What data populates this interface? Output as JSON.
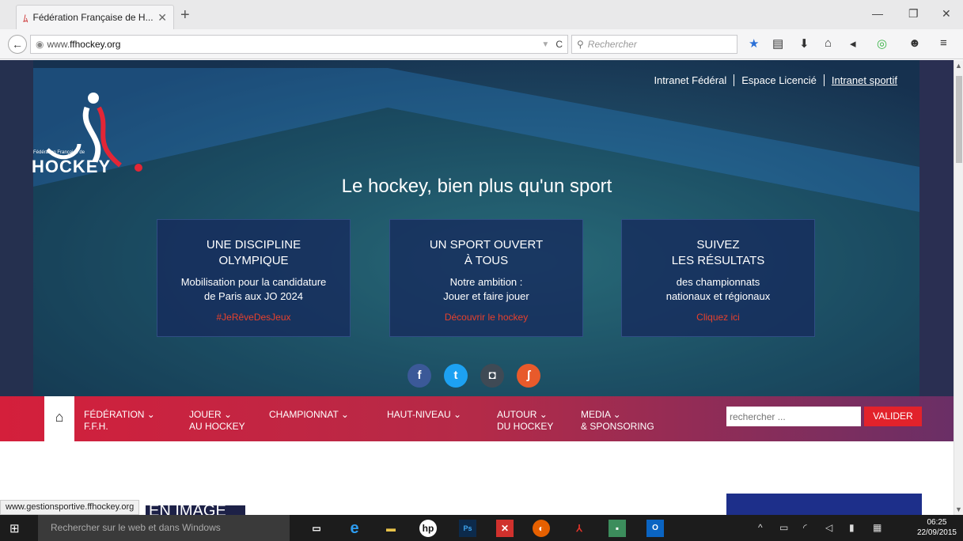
{
  "browser": {
    "tab_title": "Fédération Française de H...",
    "new_tab": "+",
    "tab_close": "✕",
    "url_prefix": "www.",
    "url_domain": "ffhockey.org",
    "search_placeholder": "Rechercher",
    "minimize": "—",
    "restore": "❐",
    "close": "✕"
  },
  "site": {
    "logo_small": "Fédération Française de",
    "logo_text": "HOCKEY",
    "top_links": [
      "Intranet Fédéral",
      "Espace Licencié",
      "Intranet sportif"
    ],
    "tagline": "Le hockey, bien plus qu'un sport",
    "cards": [
      {
        "heading1": "UNE DISCIPLINE",
        "heading2": "OLYMPIQUE",
        "desc1": "Mobilisation pour la candidature",
        "desc2": "de Paris aux JO 2024",
        "link": "#JeRêveDesJeux"
      },
      {
        "heading1": "UN SPORT OUVERT",
        "heading2": "À TOUS",
        "desc1": "Notre ambition :",
        "desc2": "Jouer et faire jouer",
        "link": "Découvrir le hockey"
      },
      {
        "heading1": "SUIVEZ",
        "heading2": "LES RÉSULTATS",
        "desc1": "des championnats",
        "desc2": "nationaux et régionaux",
        "link": "Cliquez ici"
      }
    ],
    "social": [
      {
        "name": "facebook",
        "glyph": "f",
        "color": "#3b5998"
      },
      {
        "name": "twitter",
        "glyph": "t",
        "color": "#1da1f2"
      },
      {
        "name": "instagram",
        "glyph": "◘",
        "color": "#3f4a55"
      },
      {
        "name": "rss",
        "glyph": "ʃ",
        "color": "#e85a2b"
      }
    ],
    "menu": [
      {
        "line1": "FÉDÉRATION ⌄",
        "line2": "F.F.H."
      },
      {
        "line1": "JOUER ⌄",
        "line2": "AU HOCKEY"
      },
      {
        "line1": "CHAMPIONNAT ⌄",
        "line2": ""
      },
      {
        "line1": "HAUT-NIVEAU ⌄",
        "line2": ""
      },
      {
        "line1": "AUTOUR ⌄",
        "line2": "DU HOCKEY"
      },
      {
        "line1": "MEDIA ⌄",
        "line2": "& SPONSORING"
      }
    ],
    "menu_search_placeholder": "rechercher ...",
    "menu_search_button": "VALIDER",
    "section_heading": "EN IMAGE",
    "status_url": "www.gestionsportive.ffhockey.org"
  },
  "taskbar": {
    "search_text": "Rechercher sur le web et dans Windows",
    "time": "06:25",
    "date": "22/09/2015"
  },
  "colors": {
    "menu_red": "#d41f3b",
    "menu_purple": "#6a2f66",
    "link_red": "#e8412c",
    "valider_red": "#e2222b"
  }
}
